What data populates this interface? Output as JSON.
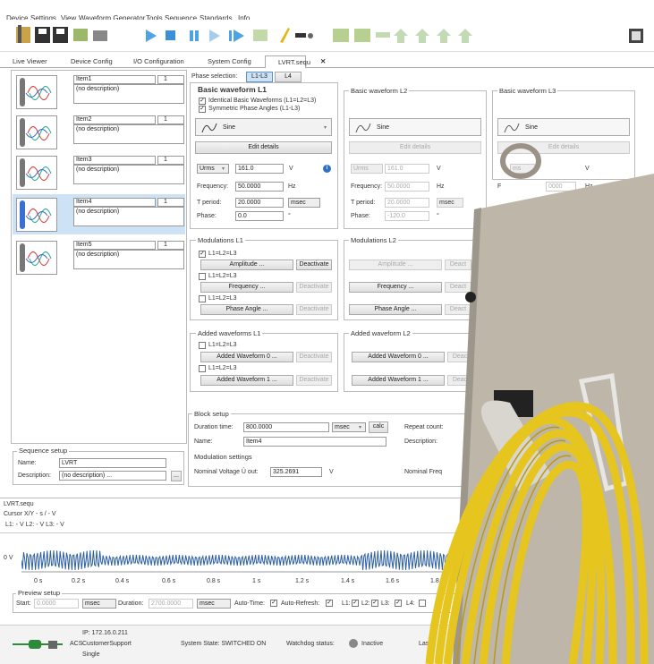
{
  "menu": [
    "Device",
    "Settings",
    "View",
    "Waveform Generator",
    "Tools",
    "Sequence",
    "Standards",
    "Info"
  ],
  "tabs": [
    "Live Viewer",
    "Device Config",
    "I/O Configuration",
    "System Config",
    "LVRT.sequ",
    "✕"
  ],
  "items": [
    {
      "name": "Item1",
      "num": "1",
      "desc": "(no description)"
    },
    {
      "name": "Item2",
      "num": "1",
      "desc": "(no description)"
    },
    {
      "name": "Item3",
      "num": "1",
      "desc": "(no description)"
    },
    {
      "name": "Item4",
      "num": "1",
      "desc": "(no description)"
    },
    {
      "name": "Item5",
      "num": "1",
      "desc": "(no description)"
    }
  ],
  "phase_selection": {
    "label": "Phase selection:",
    "opt1": "L1-L3",
    "opt2": "L4"
  },
  "l1": {
    "title": "Basic waveform L1",
    "cb1": "Identical Basic Waveforms (L1=L2=L3)",
    "cb2": "Symmetric Phase Angles (L1-L3)",
    "wave": "Sine",
    "edit": "Edit details",
    "mode": "Urms",
    "value": "161.0",
    "unit": "V",
    "freq_label": "Frequency:",
    "freq": "50.0000",
    "freq_unit": "Hz",
    "tperiod_label": "T period:",
    "tperiod": "20.0000",
    "tperiod_unit": "msec",
    "phase_label": "Phase:",
    "phase": "0.0",
    "phase_unit": "°"
  },
  "l2": {
    "title": "Basic waveform L2",
    "wave": "Sine",
    "edit": "Edit details",
    "mode": "Urms",
    "value": "161.0",
    "unit": "V",
    "freq_label": "Frequency:",
    "freq": "50.0000",
    "freq_unit": "Hz",
    "tperiod_label": "T period:",
    "tperiod": "20.0000",
    "tperiod_unit": "msec",
    "phase_label": "Phase:",
    "phase": "-120.0",
    "phase_unit": "°"
  },
  "l3": {
    "title": "Basic waveform L3",
    "wave": "Sine",
    "edit": "Edit details",
    "mode_part": "ms",
    "unit": "V",
    "freq_part": "0000",
    "freq_unit": "Hz",
    "f_letter": "F"
  },
  "mod_l1": {
    "title": "Modulations L1",
    "cb": "L1=L2=L3",
    "amplitude": "Amplitude ...",
    "frequency": "Frequency ...",
    "phase": "Phase Angle ...",
    "deactivate": "Deactivate"
  },
  "mod_l2": {
    "title": "Modulations L2",
    "amplitude": "Amplitude ...",
    "frequency": "Frequency ...",
    "phase": "Phase Angle ...",
    "deact": "Deact"
  },
  "add_l1": {
    "title": "Added waveforms L1",
    "cb": "L1=L2=L3",
    "w0": "Added Waveform 0 ...",
    "w1": "Added Waveform 1 ...",
    "deactivate": "Deactivate"
  },
  "add_l2": {
    "title": "Added waveform L2",
    "w0": "Added Waveform 0 ...",
    "w1": "Added Waveform 1 ...",
    "deact": "Deact"
  },
  "block": {
    "title": "Block setup",
    "duration_label": "Duration time:",
    "duration": "800.0000",
    "duration_unit": "msec",
    "calc": "calc",
    "name_label": "Name:",
    "name": "Item4",
    "repeat_label": "Repeat count:",
    "desc_label": "Description:",
    "mod_title": "Modulation settings",
    "nominal_label": "Nominal Voltage Û out:",
    "nominal": "325.2691",
    "nominal_unit": "V",
    "nominal_freq": "Nominal Freq"
  },
  "sequence": {
    "title": "Sequence setup",
    "name_label": "Name:",
    "name": "LVRT",
    "desc_label": "Description:",
    "desc": "(no description) ...",
    "more": "..."
  },
  "viewer": {
    "file": "LVRT.sequ",
    "cursor": "Cursor X/Y - s / - V",
    "readout": "L1: - V   L2: - V   L3: - V",
    "y0": "0 V",
    "ticks": [
      "0 s",
      "0.2 s",
      "0.4 s",
      "0.6 s",
      "0.8 s",
      "1 s",
      "1.2 s",
      "1.4 s",
      "1.6 s",
      "1.8"
    ]
  },
  "preview": {
    "title": "Preview setup",
    "start_label": "Start:",
    "start": "0.0000",
    "unit": "msec",
    "duration_label": "Duration:",
    "duration": "2700.0000",
    "autotime": "Auto-Time:",
    "autorefresh": "Auto-Refresh:",
    "l1": "L1:",
    "l2": "L2:",
    "l3": "L3:",
    "l4": "L4:"
  },
  "status": {
    "ip": "IP: 172.16.0.211",
    "acs": "ACS",
    "user": "CustomerSupport",
    "mode": "Single",
    "system": "System State: SWITCHED ON",
    "watchdog": "Watchdog status:",
    "watch_state": "Inactive",
    "last": "Las"
  },
  "colors": {
    "accent": "#2c73c8",
    "selected_row": "#cde3f5",
    "waveform": "#2d5fa0",
    "cable": "#e6c51e",
    "plate": "#bdb6a9"
  }
}
